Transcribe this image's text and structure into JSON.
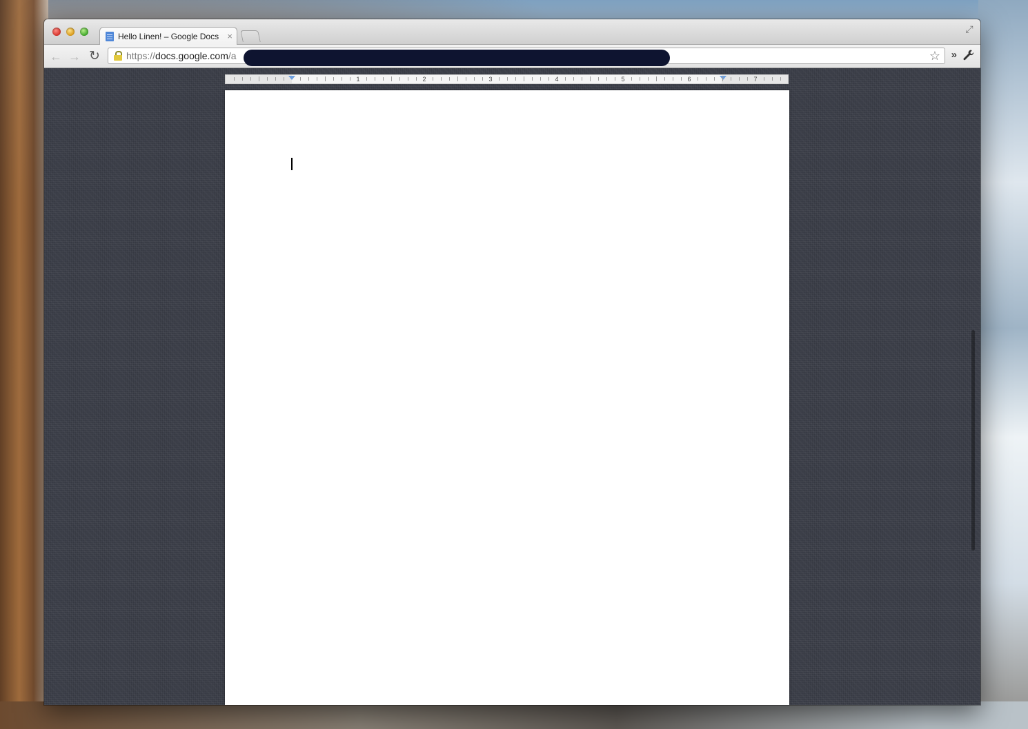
{
  "browser": {
    "tab": {
      "title": "Hello Linen! – Google Docs"
    },
    "address_bar": {
      "scheme": "https://",
      "host": "docs.google.com",
      "path": "/a"
    }
  },
  "document": {
    "ruler": {
      "numbers": [
        "1",
        "2",
        "3",
        "4",
        "5",
        "6",
        "7"
      ]
    },
    "body_text": ""
  },
  "theme": {
    "background_texture": "linen",
    "page_color": "#ffffff",
    "linen_color": "#3b3e48"
  }
}
